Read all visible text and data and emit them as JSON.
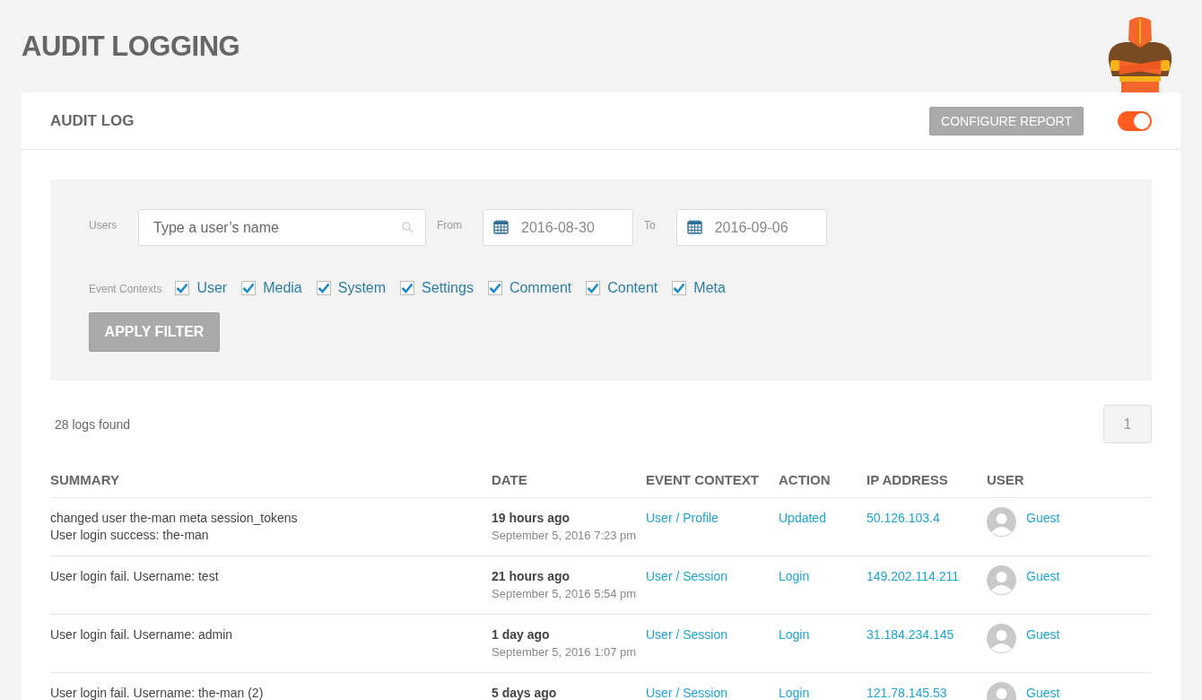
{
  "page_title": "AUDIT LOGGING",
  "card": {
    "title": "AUDIT LOG",
    "configure_button": "CONFIGURE REPORT",
    "toggle": {
      "on": true
    }
  },
  "filter": {
    "users_label": "Users",
    "users_field": {
      "placeholder": "Type a user’s name"
    },
    "from_label": "From",
    "from_field": {
      "value": "2016-08-30"
    },
    "to_label": "To",
    "to_field": {
      "value": "2016-09-06"
    },
    "contexts_label": "Event Contexts",
    "contexts": [
      {
        "label": "User",
        "checked": true
      },
      {
        "label": "Media",
        "checked": true
      },
      {
        "label": "System",
        "checked": true
      },
      {
        "label": "Settings",
        "checked": true
      },
      {
        "label": "Comment",
        "checked": true
      },
      {
        "label": "Content",
        "checked": true
      },
      {
        "label": "Meta",
        "checked": true
      }
    ],
    "apply_button": "APPLY FILTER"
  },
  "results": {
    "count": "28 logs found",
    "pages": [
      "1"
    ]
  },
  "table": {
    "columns": [
      "SUMMARY",
      "DATE",
      "EVENT CONTEXT",
      "ACTION",
      "IP ADDRESS",
      "USER"
    ],
    "rows": [
      {
        "summary": [
          "changed user the-man meta session_tokens",
          "User login success: the-man"
        ],
        "time_ago": "19 hours ago",
        "date": "September 5, 2016 7:23 pm",
        "context": "User / Profile",
        "action": "Updated",
        "ip": "50.126.103.4",
        "user": "Guest"
      },
      {
        "summary": [
          "User login fail. Username: test"
        ],
        "time_ago": "21 hours ago",
        "date": "September 5, 2016 5:54 pm",
        "context": "User / Session",
        "action": "Login",
        "ip": "149.202.114.211",
        "user": "Guest"
      },
      {
        "summary": [
          "User login fail. Username: admin"
        ],
        "time_ago": "1 day ago",
        "date": "September 5, 2016 1:07 pm",
        "context": "User / Session",
        "action": "Login",
        "ip": "31.184.234.145",
        "user": "Guest"
      },
      {
        "summary": [
          "User login fail. Username: the-man (2)"
        ],
        "time_ago": "5 days ago",
        "context": "User / Session",
        "action": "Login",
        "ip": "121.78.145.53",
        "user": "Guest"
      }
    ]
  }
}
